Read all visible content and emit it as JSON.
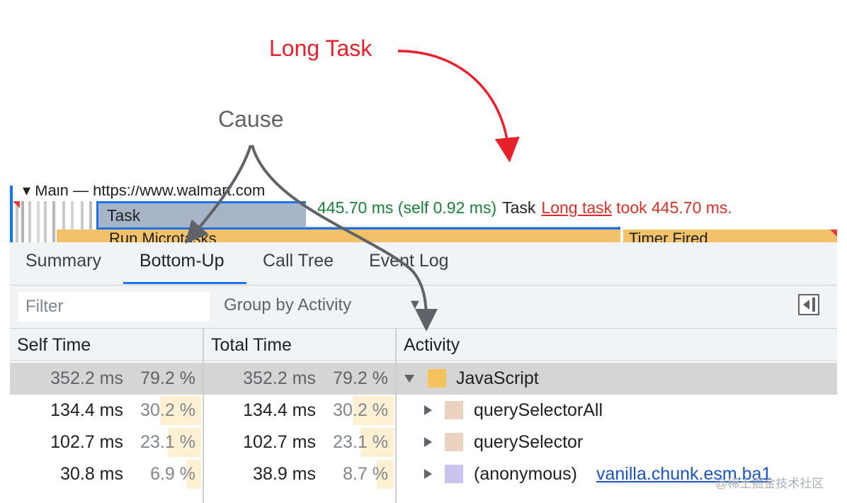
{
  "annotations": {
    "long_task": "Long Task",
    "cause": "Cause"
  },
  "timeline": {
    "main_row": "▾  Main  — https://www.walmart.com",
    "task_label": "Task",
    "microtasks_label": "Run Microtasks",
    "timer_label": "Timer Fired"
  },
  "tooltip": {
    "duration": "445.70 ms (self 0.92 ms)",
    "name": "Task",
    "link": "Long task",
    "message": "took 445.70 ms."
  },
  "tabs": [
    "Summary",
    "Bottom-Up",
    "Call Tree",
    "Event Log"
  ],
  "active_tab": "Bottom-Up",
  "filter": {
    "placeholder": "Filter",
    "group_by": "Group by Activity"
  },
  "table": {
    "headers": {
      "self_time": "Self Time",
      "total_time": "Total Time",
      "activity": "Activity"
    },
    "rows": [
      {
        "self_ms": "352.2 ms",
        "self_pct": "79.2 %",
        "total_ms": "352.2 ms",
        "total_pct": "79.2 %",
        "name": "JavaScript",
        "link": "",
        "swatch": "#f5c35c",
        "expanded": true,
        "self_fill": 0.792,
        "total_fill": 0.792
      },
      {
        "self_ms": "134.4 ms",
        "self_pct": "30.2 %",
        "total_ms": "134.4 ms",
        "total_pct": "30.2 %",
        "name": "querySelectorAll",
        "link": "",
        "swatch": "#ead3c0",
        "expanded": false,
        "self_fill": 0.302,
        "total_fill": 0.302
      },
      {
        "self_ms": "102.7 ms",
        "self_pct": "23.1 %",
        "total_ms": "102.7 ms",
        "total_pct": "23.1 %",
        "name": "querySelector",
        "link": "",
        "swatch": "#ead3c0",
        "expanded": false,
        "self_fill": 0.231,
        "total_fill": 0.231
      },
      {
        "self_ms": "30.8 ms",
        "self_pct": "6.9 %",
        "total_ms": "38.9 ms",
        "total_pct": "8.7 %",
        "name": "(anonymous)",
        "link": "vanilla.chunk.esm.ba1",
        "swatch": "#c9c3ee",
        "expanded": false,
        "self_fill": 0.069,
        "total_fill": 0.087
      }
    ]
  },
  "colors": {
    "annotation_red": "#e8202a",
    "tab_accent": "#1a73e8",
    "pct_highlight": "#fdf0d3"
  },
  "watermark": "@稀土掘金技术社区"
}
